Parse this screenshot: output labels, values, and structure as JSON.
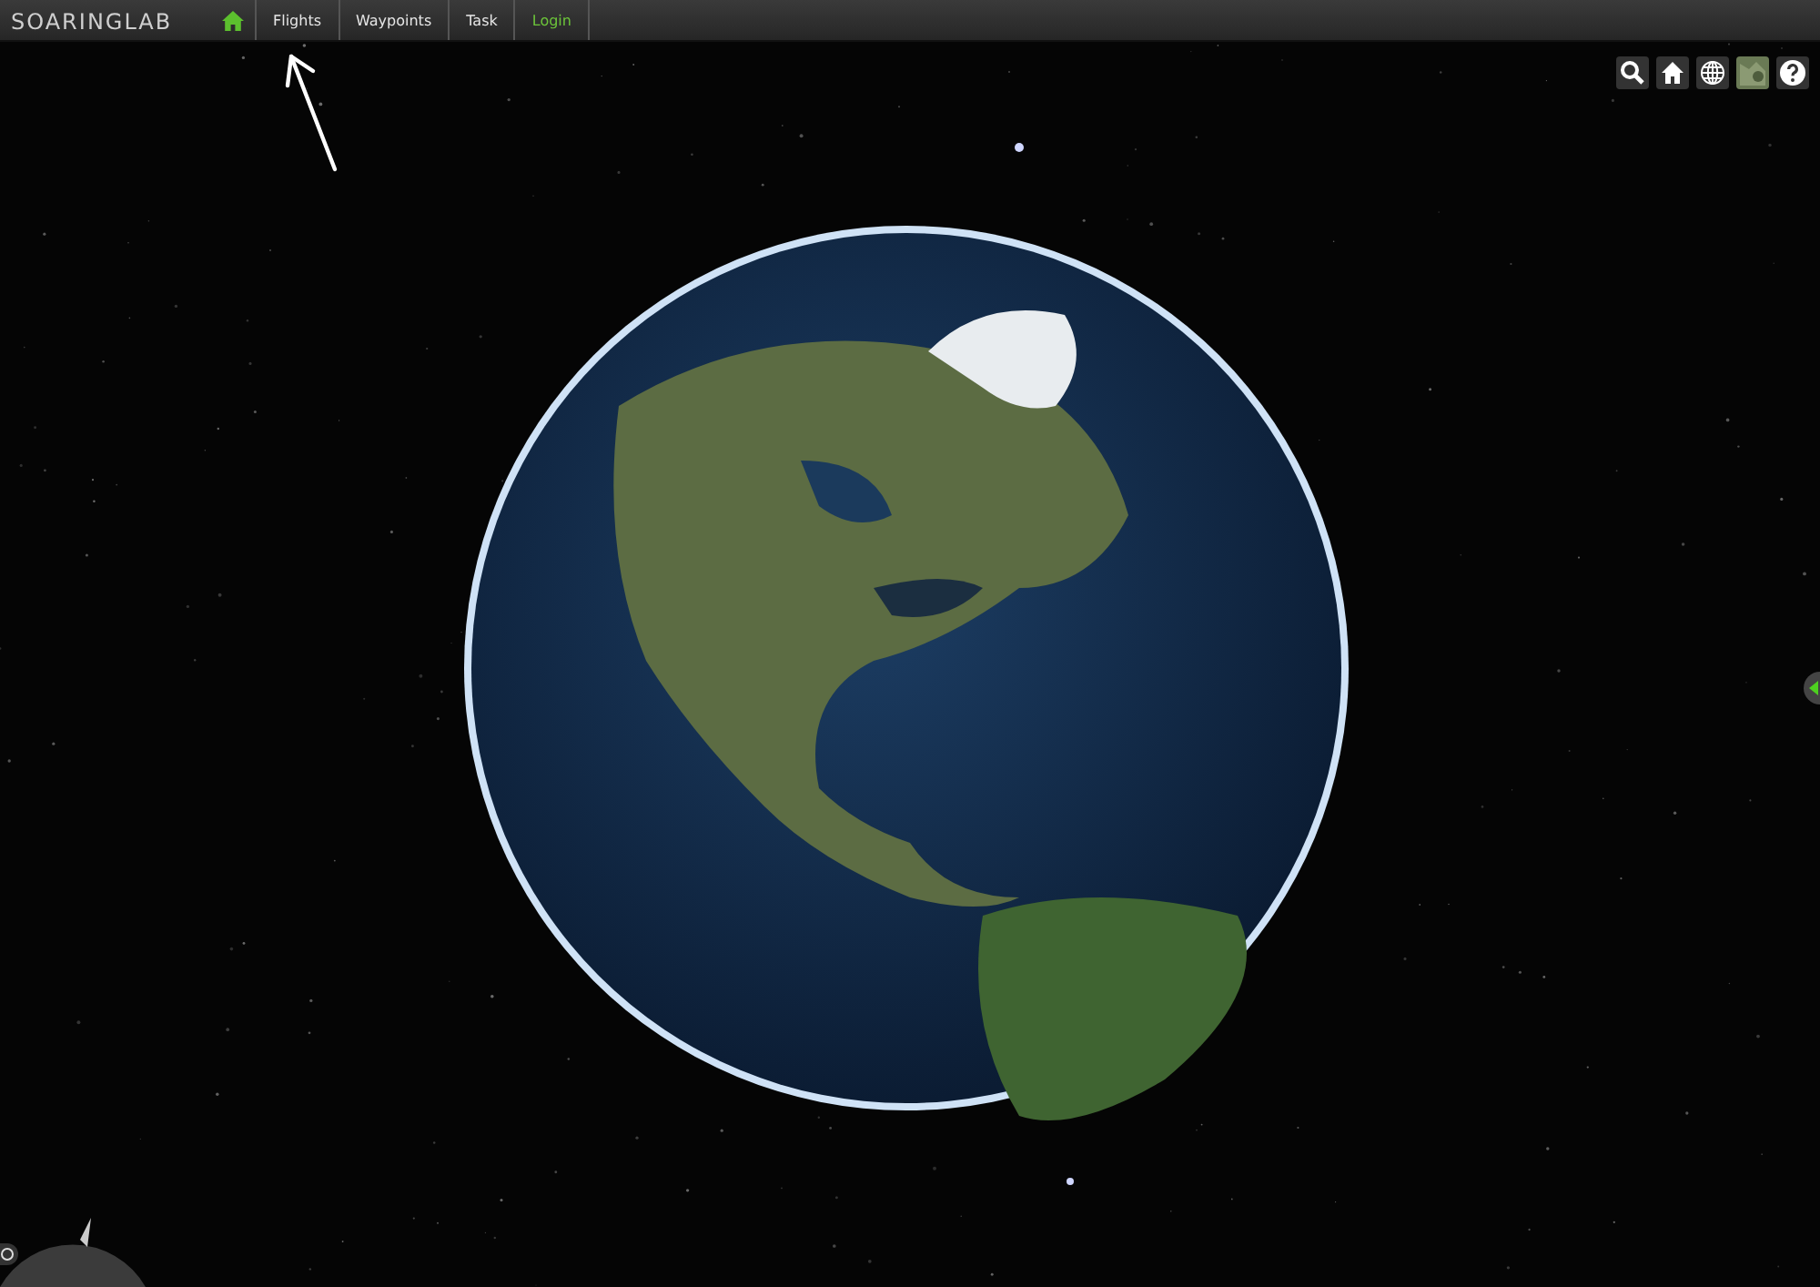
{
  "header": {
    "logo": "SOARINGLAB",
    "nav": [
      {
        "label": "Flights",
        "kind": "tab"
      },
      {
        "label": "Waypoints",
        "kind": "tab"
      },
      {
        "label": "Task",
        "kind": "tab"
      },
      {
        "label": "Login",
        "kind": "login"
      }
    ]
  }
}
